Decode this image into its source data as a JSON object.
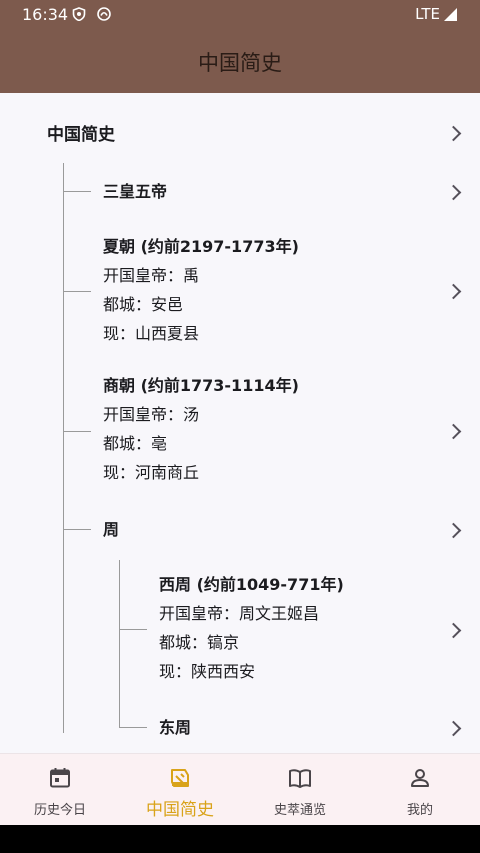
{
  "status": {
    "time": "16:34",
    "network": "LTE"
  },
  "appbar": {
    "title": "中国简史"
  },
  "tree": {
    "root": "中国简史",
    "sanhuang": {
      "title": "三皇五帝"
    },
    "xia": {
      "title": "夏朝 (约前2197-1773年)",
      "founder": "开国皇帝：禹",
      "capital": "都城：安邑",
      "now": "现：山西夏县"
    },
    "shang": {
      "title": "商朝 (约前1773-1114年)",
      "founder": "开国皇帝：汤",
      "capital": "都城：亳",
      "now": "现：河南商丘"
    },
    "zhou": {
      "title": "周",
      "xizhou": {
        "title": "西周 (约前1049-771年)",
        "founder": "开国皇帝：周文王姬昌",
        "capital": "都城：镐京",
        "now": "现：陕西西安"
      },
      "dongzhou": {
        "title": "东周"
      }
    }
  },
  "nav": {
    "items": [
      {
        "label": "历史今日",
        "icon": "calendar-icon"
      },
      {
        "label": "中国简史",
        "icon": "scroll-icon",
        "active": true
      },
      {
        "label": "史萃通览",
        "icon": "book-icon"
      },
      {
        "label": "我的",
        "icon": "person-icon"
      }
    ],
    "active_color": "#d9a31a"
  },
  "colors": {
    "brand": "#7d5a4d",
    "background": "#f8f7fb",
    "nav_background": "#fbf1f3"
  }
}
